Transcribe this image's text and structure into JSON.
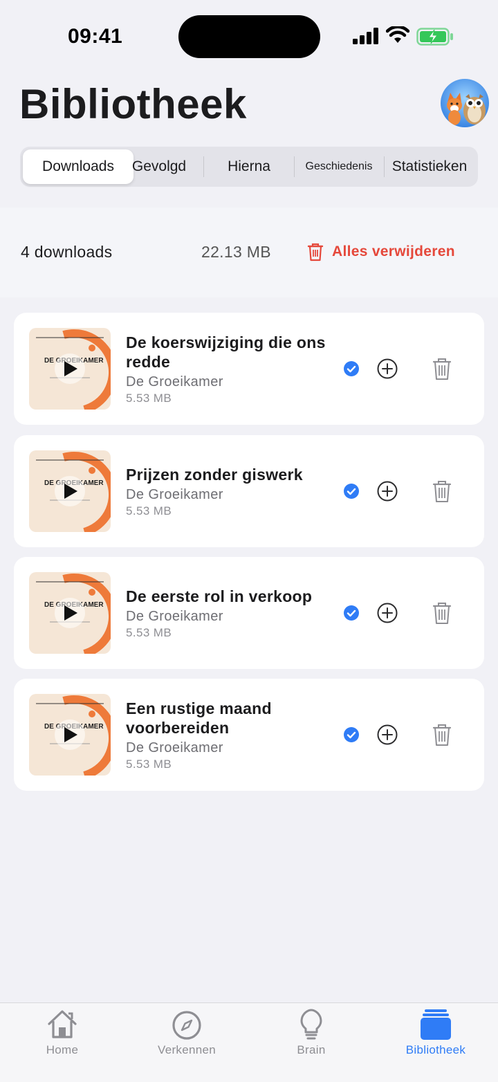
{
  "status_bar": {
    "time": "09:41"
  },
  "header": {
    "title": "Bibliotheek"
  },
  "tabs": [
    "Downloads",
    "Gevolgd",
    "Hierna",
    "Geschiedenis",
    "Statistieken"
  ],
  "summary": {
    "count": "4 downloads",
    "total_size": "22.13 MB",
    "delete_all": "Alles verwijderen"
  },
  "thumbnail_text": "DE GROEIKAMER",
  "episodes": [
    {
      "title": "De koerswijziging die ons redde",
      "podcast": "De Groeikamer",
      "size": "5.53 MB",
      "downloaded": true
    },
    {
      "title": "Prijzen zonder giswerk",
      "podcast": "De Groeikamer",
      "size": "5.53 MB",
      "downloaded": true
    },
    {
      "title": "De eerste rol in verkoop",
      "podcast": "De Groeikamer",
      "size": "5.53 MB",
      "downloaded": true
    },
    {
      "title": "Een rustige maand voorbereiden",
      "podcast": "De Groeikamer",
      "size": "5.53 MB",
      "downloaded": true
    }
  ],
  "bottom_nav": [
    {
      "label": "Home",
      "icon": "home-icon"
    },
    {
      "label": "Verkennen",
      "icon": "compass-icon"
    },
    {
      "label": "Brain",
      "icon": "lightbulb-icon"
    },
    {
      "label": "Bibliotheek",
      "icon": "library-icon",
      "active": true
    }
  ],
  "colors": {
    "accent": "#2f7cf6",
    "destructive": "#e5483b",
    "thumbnail_orange": "#ee7a3a",
    "battery_green": "#34c759"
  }
}
